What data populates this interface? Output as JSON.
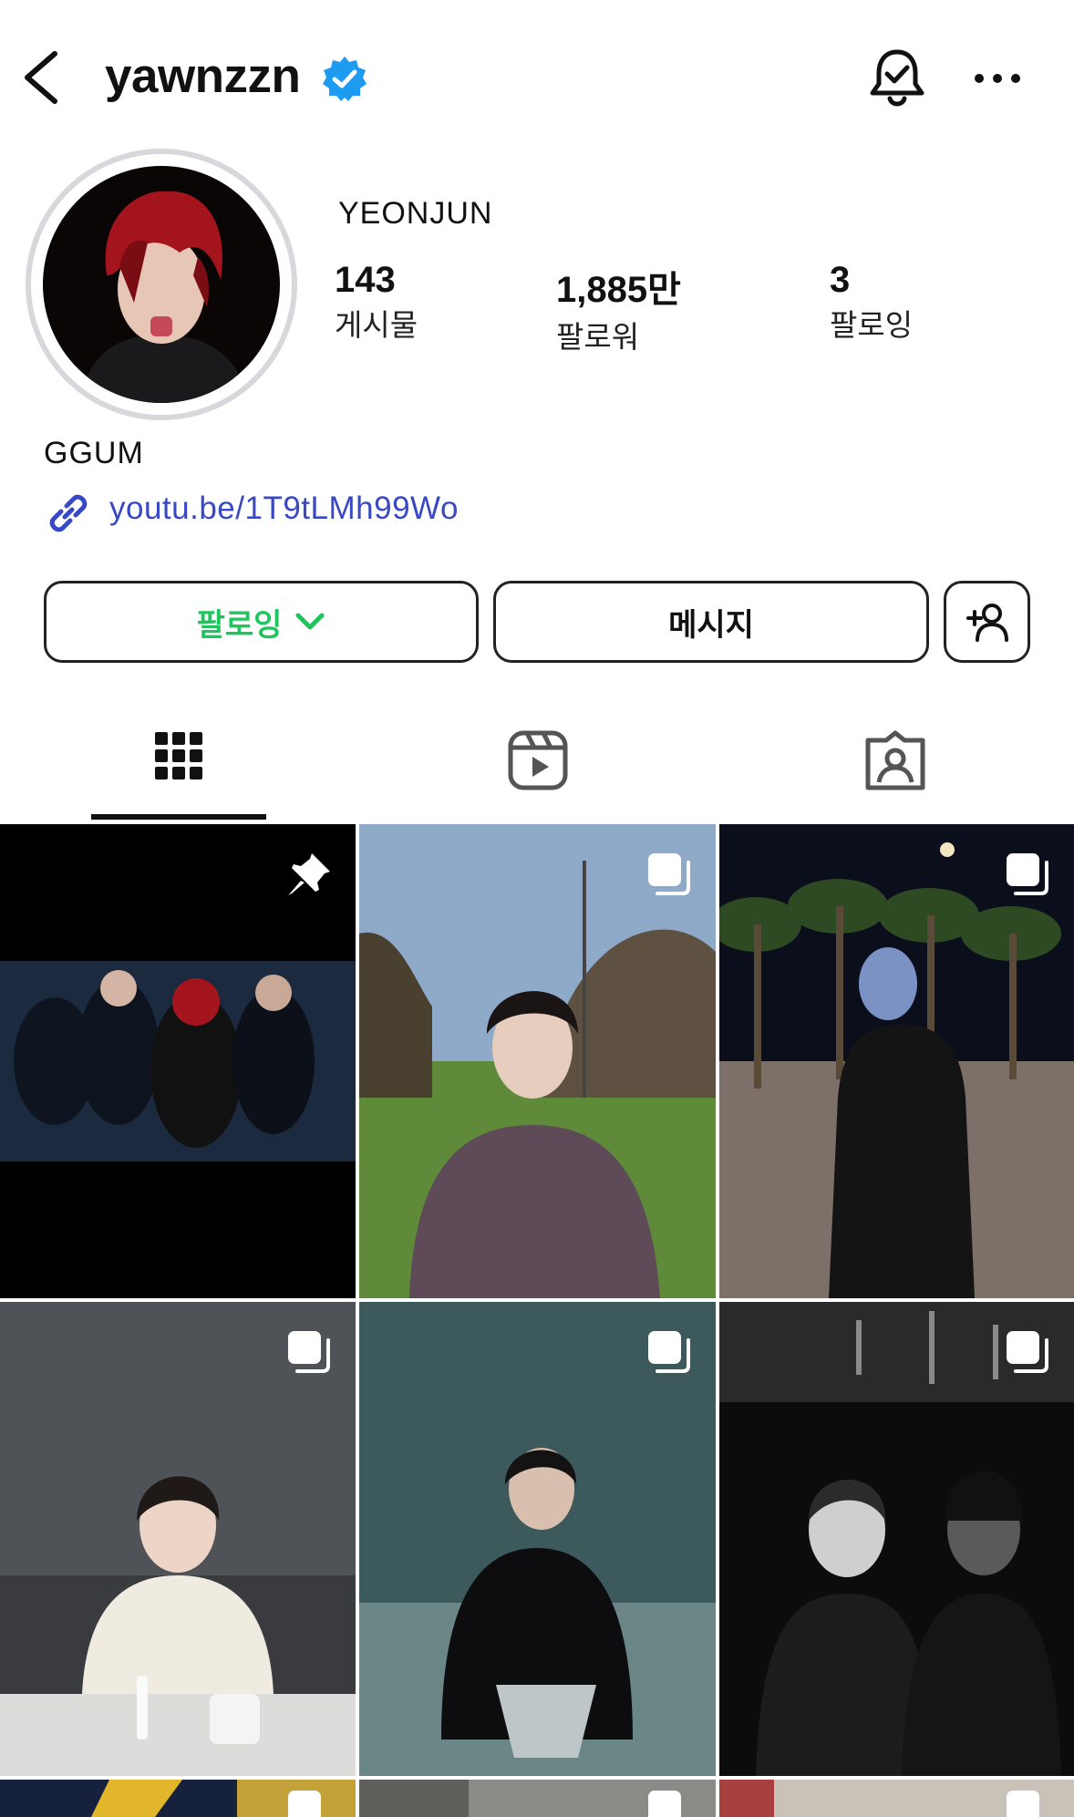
{
  "header": {
    "username": "yawnzzn"
  },
  "profile": {
    "display_name": "YEONJUN",
    "stats": [
      {
        "value": "143",
        "label": "게시물"
      },
      {
        "value": "1,885만",
        "label": "팔로워"
      },
      {
        "value": "3",
        "label": "팔로잉"
      }
    ],
    "bio_name": "GGUM",
    "link": "youtu.be/1T9tLMh99Wo"
  },
  "actions": {
    "follow_label": "팔로잉",
    "message_label": "메시지"
  },
  "tabs": [
    {
      "icon": "grid-icon",
      "selected": true
    },
    {
      "icon": "reels-icon",
      "selected": false
    },
    {
      "icon": "tagged-icon",
      "selected": false
    }
  ],
  "posts": [
    {
      "overlay": "pin-icon"
    },
    {
      "overlay": "carousel-icon"
    },
    {
      "overlay": "carousel-icon"
    },
    {
      "overlay": "carousel-icon"
    },
    {
      "overlay": "carousel-icon"
    },
    {
      "overlay": "carousel-icon"
    },
    {
      "overlay": "carousel-icon"
    },
    {
      "overlay": "carousel-icon"
    },
    {
      "overlay": "carousel-icon"
    }
  ],
  "colors": {
    "accent_follow": "#21c55d",
    "link": "#3948c4",
    "verified": "#1d9bf0"
  }
}
